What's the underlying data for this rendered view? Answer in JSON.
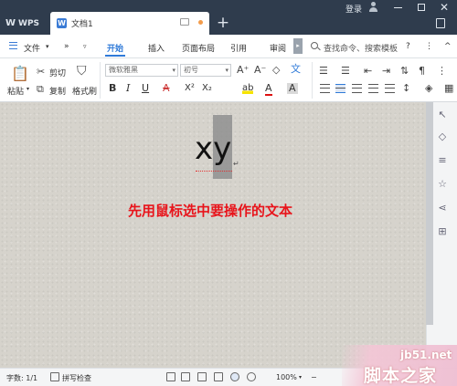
{
  "titlebar": {
    "app_name": "WPS",
    "doc_tab_icon": "W",
    "doc_tab_name": "文档1",
    "new_tab": "+",
    "login": "登录"
  },
  "menubar": {
    "file": "文件",
    "more": "»",
    "tabs": [
      "开始",
      "插入",
      "页面布局",
      "引用",
      "审阅"
    ],
    "scroll_label": "▸",
    "search_placeholder": "查找命令、搜索模板",
    "help": "?",
    "more_options": "⋮",
    "collapse": "^"
  },
  "ribbon": {
    "paste_label": "粘贴",
    "cut_label": "剪切",
    "copy_label": "复制",
    "format_painter_label": "格式刷",
    "font_name": "微软雅黑",
    "font_size": "初号",
    "grow_font": "A⁺",
    "shrink_font": "A⁻",
    "bold": "B",
    "italic": "I",
    "underline": "U",
    "strike": "A",
    "superscript": "X²",
    "subscript": "X₂",
    "highlight": "ab",
    "font_color": "A",
    "char_shading": "A",
    "clear": "◇",
    "phonetic": "文"
  },
  "document": {
    "text": "xy",
    "instruction": "先用鼠标选中要操作的文本"
  },
  "statusbar": {
    "word_count": "字数: 1/1",
    "spell_check": "拼写检查",
    "zoom": "100%",
    "zoom_minus": "−",
    "zoom_plus": "+"
  },
  "watermark": {
    "site": "jb51.net",
    "name": "脚本之家"
  },
  "colors": {
    "titlebar_bg": "#2f3c4d",
    "accent": "#2f7ad8",
    "instruction_text": "#e8141b",
    "selection": "#8f8f8f"
  },
  "icons": [
    "wps-logo-icon",
    "word-doc-icon",
    "monitor-icon",
    "unsaved-dot-icon",
    "user-icon",
    "minimize-icon",
    "maximize-icon",
    "close-icon",
    "sidebar-toggle-icon",
    "menu-icon",
    "search-icon",
    "paste-icon",
    "cut-icon",
    "copy-icon",
    "format-painter-icon",
    "bullet-list-icon",
    "numbered-list-icon",
    "align-left-icon",
    "align-center-icon",
    "align-right-icon",
    "justify-icon",
    "line-spacing-icon",
    "shading-icon",
    "borders-icon",
    "style-icon",
    "format-icon",
    "cursor-icon",
    "share-icon",
    "star-icon",
    "settings-icon",
    "apps-icon",
    "view-icon",
    "read-icon",
    "outline-icon",
    "web-icon",
    "eye-icon"
  ]
}
